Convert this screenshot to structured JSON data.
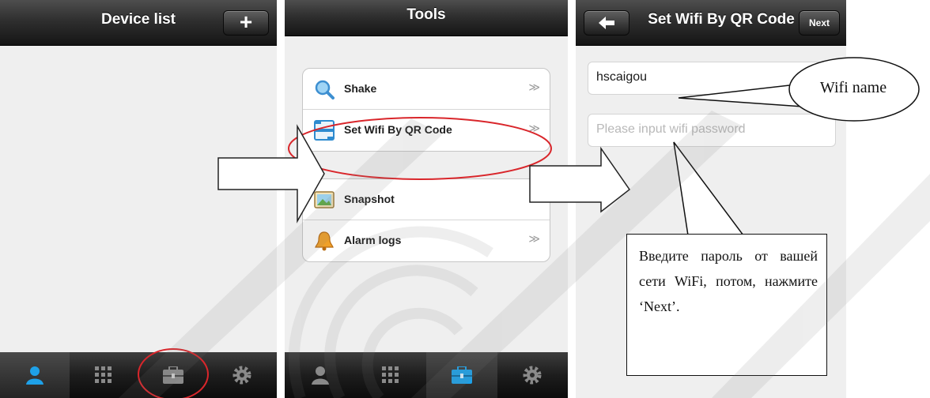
{
  "screen1": {
    "title": "Device list",
    "add_button": "+",
    "tabs": [
      {
        "icon": "person-icon",
        "active": true
      },
      {
        "icon": "grid-icon",
        "active": false
      },
      {
        "icon": "toolbox-icon",
        "active": false
      },
      {
        "icon": "gear-icon",
        "active": false
      }
    ]
  },
  "screen2": {
    "title": "Tools",
    "items": [
      {
        "label": "Shake",
        "icon": "magnifier-icon",
        "arrow": "≫"
      },
      {
        "label": "Set Wifi By QR Code",
        "icon": "qr-scan-icon",
        "arrow": "≫"
      },
      {
        "label": "Snapshot",
        "icon": "picture-icon",
        "arrow": "≫"
      },
      {
        "label": "Alarm logs",
        "icon": "bell-icon",
        "arrow": "≫"
      }
    ],
    "tabs": [
      {
        "icon": "person-icon",
        "active": false
      },
      {
        "icon": "grid-icon",
        "active": false
      },
      {
        "icon": "toolbox-icon",
        "active": true
      },
      {
        "icon": "gear-icon",
        "active": false
      }
    ]
  },
  "screen3": {
    "title": "Set Wifi By QR Code",
    "back_icon": "back-arrow-icon",
    "next_button": "Next",
    "wifi_name_value": "hscaigou",
    "password_placeholder": "Please input wifi password"
  },
  "annotations": {
    "bubble_label": "Wifi name",
    "note_text": "Введите пароль от вашей сети WiFi, потом, нажмите ‘Next’.",
    "highlight_color": "#d9262b"
  },
  "colors": {
    "accent_blue": "#1ea1e8",
    "bar_dark": "#1d1d1d",
    "screen_bg": "#efefef"
  }
}
